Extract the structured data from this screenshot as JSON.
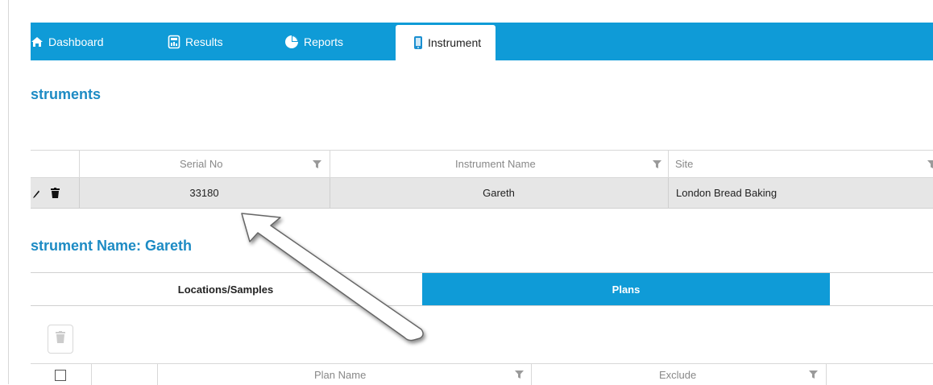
{
  "nav": {
    "items": [
      {
        "label": "Dashboard",
        "icon": "home-icon"
      },
      {
        "label": "Results",
        "icon": "calculator-icon"
      },
      {
        "label": "Reports",
        "icon": "pie-chart-icon"
      },
      {
        "label": "Instrument",
        "icon": "phone-icon",
        "active": true
      }
    ]
  },
  "instruments": {
    "title": "struments",
    "columns": [
      "Serial No",
      "Instrument Name",
      "Site"
    ],
    "rows": [
      {
        "serial_no": "33180",
        "instrument_name": "Gareth",
        "site": "London Bread Baking"
      }
    ]
  },
  "detail": {
    "title": "strument Name: Gareth",
    "tabs": [
      {
        "label": "Locations/Samples"
      },
      {
        "label": "Plans",
        "active": true
      }
    ],
    "plan_columns": [
      "Plan Name",
      "Exclude"
    ]
  },
  "colors": {
    "accent": "#0f9bd7",
    "title": "#1d8bc4",
    "row_bg": "#e6e6e6"
  }
}
